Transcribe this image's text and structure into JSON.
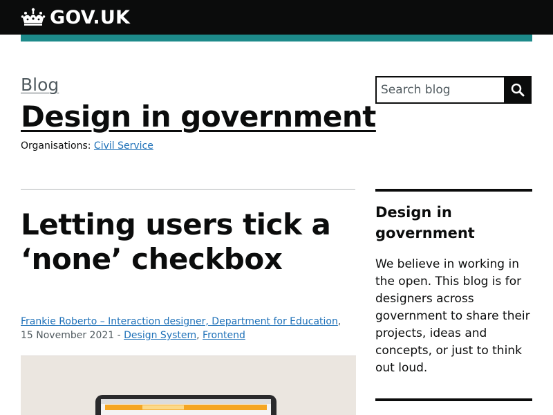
{
  "header": {
    "logo_text": "GOV.UK",
    "logo_icon": "crown-icon",
    "background_color": "#0b0c0c",
    "accent_bar_color": "#1d8a8a"
  },
  "blog": {
    "blog_label": "Blog",
    "title": "Design in government",
    "organisations_label": "Organisations:",
    "organisation_link": "Civil Service"
  },
  "search": {
    "placeholder": "Search blog",
    "value": "",
    "button_icon": "search-icon"
  },
  "post": {
    "title": "Letting users tick a ‘none’ checkbox",
    "author_link": "Frankie Roberto – Interaction designer, Department for Education",
    "date": "15 November 2021",
    "separator": " - ",
    "categories": [
      "Design System",
      "Frontend"
    ]
  },
  "sidebar": {
    "heading": "Design in government",
    "description": "We believe in working in the open. This blog is for designers across government to share their projects, ideas and concepts, or just to think out loud."
  },
  "colors": {
    "link": "#1d70b8",
    "text": "#0b0c0c",
    "secondary_text": "#505a5f"
  }
}
